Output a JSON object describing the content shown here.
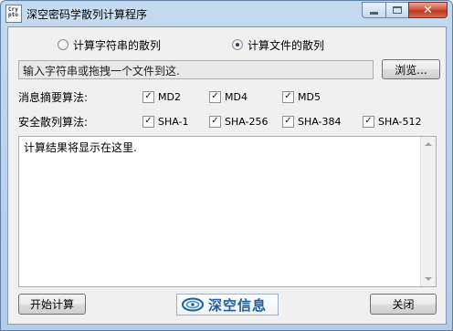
{
  "window": {
    "title": "深空密码学散列计算程序",
    "app_icon_text": "Cry\npto",
    "close_glyph": "✕"
  },
  "mode": {
    "option_string": "计算字符串的散列",
    "option_file": "计算文件的散列",
    "selected": "file"
  },
  "input": {
    "value": "输入字符串或拖拽一个文件到这.",
    "browse_label": "浏览..."
  },
  "digest_row": {
    "label": "消息摘要算法:",
    "items": [
      {
        "label": "MD2",
        "checked": true
      },
      {
        "label": "MD4",
        "checked": true
      },
      {
        "label": "MD5",
        "checked": true
      }
    ]
  },
  "sha_row": {
    "label": "安全散列算法:",
    "items": [
      {
        "label": "SHA-1",
        "checked": true
      },
      {
        "label": "SHA-256",
        "checked": true
      },
      {
        "label": "SHA-384",
        "checked": true
      },
      {
        "label": "SHA-512",
        "checked": true
      }
    ]
  },
  "result": {
    "text": "计算结果将显示在这里."
  },
  "footer": {
    "start_label": "开始计算",
    "logo_text": "深空信息",
    "close_label": "关闭"
  },
  "colors": {
    "title_bar": "#b9d1ea",
    "close_button": "#c7432a",
    "logo_blue": "#1c5ea6"
  }
}
